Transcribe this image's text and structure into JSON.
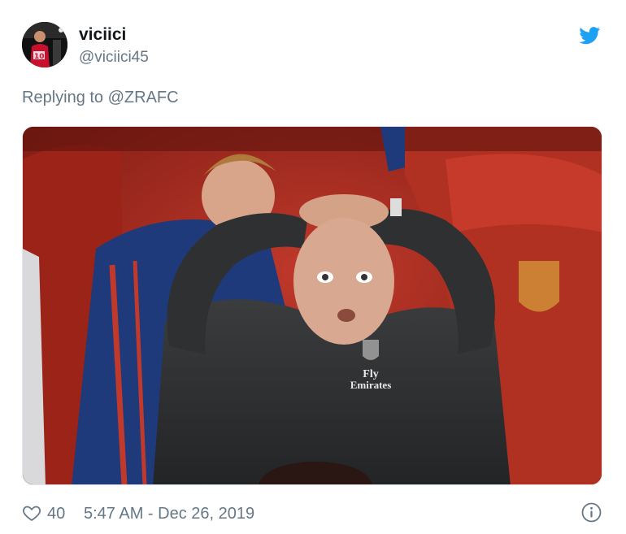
{
  "tweet": {
    "author": {
      "display_name": "viciici",
      "handle": "@viciici45",
      "avatar_icon": "player-avatar"
    },
    "brand_icon": "twitter-bird-icon",
    "brand_color": "#1da1f2",
    "replying_to": "Replying to @ZRAFC",
    "media": {
      "kit_text": "Fly\nEmirates",
      "icon": "photo"
    },
    "footer": {
      "like_icon": "heart-outline-icon",
      "like_count": "40",
      "timestamp": "5:47 AM - Dec 26, 2019",
      "info_icon": "info-icon"
    },
    "text_muted_color": "#657786"
  }
}
